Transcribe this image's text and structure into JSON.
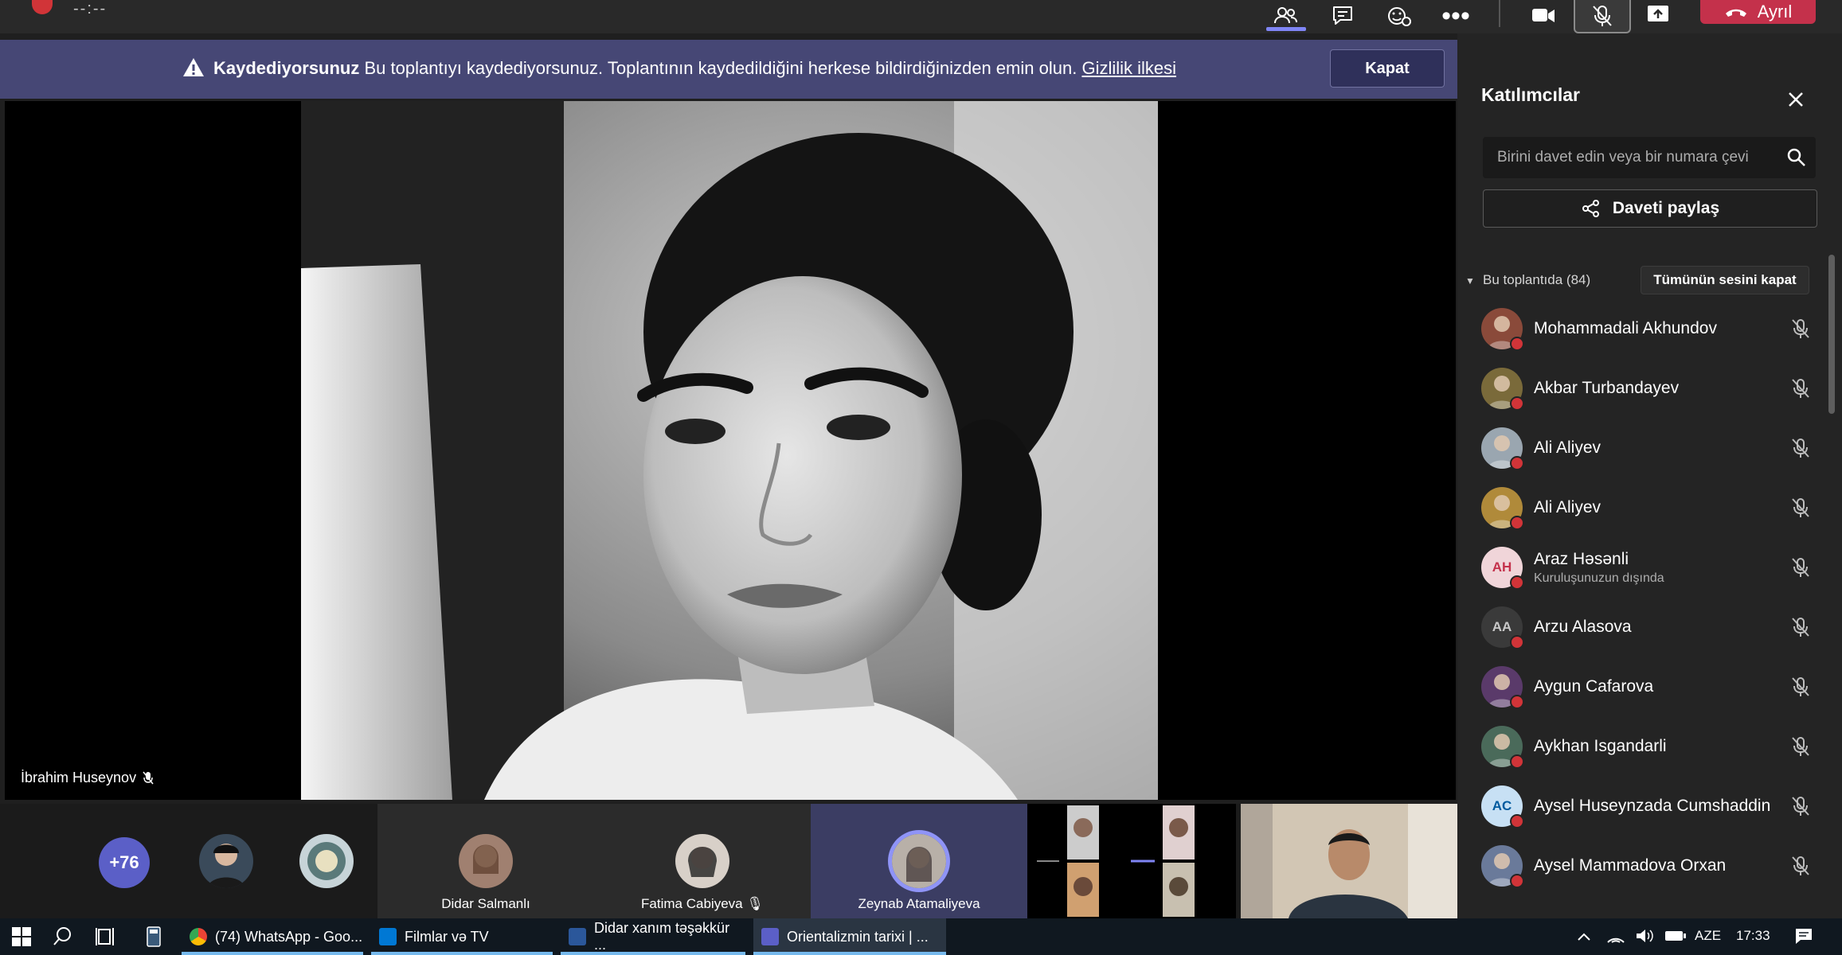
{
  "toolbar": {
    "timer": "--:--",
    "leave_label": "Ayrıl"
  },
  "banner": {
    "title": "Kaydediyorsunuz",
    "message": "Bu toplantıyı kaydediyorsunuz. Toplantının kaydedildiğini herkese bildirdiğinizden emin olun.",
    "link": "Gizlilik ilkesi",
    "close_label": "Kapat"
  },
  "stage": {
    "speaker_name": "İbrahim Huseynov"
  },
  "strip": {
    "more_count": "+76",
    "tiles": [
      {
        "name": "Didar Salmanlı"
      },
      {
        "name": "Fatima Cabiyeva"
      },
      {
        "name": "Zeynab Atamaliyeva"
      }
    ]
  },
  "panel": {
    "title": "Katılımcılar",
    "search_placeholder": "Birini davet edin veya bir numara çevi",
    "share_invite_label": "Daveti paylaş",
    "section_label": "Bu toplantıda (84)",
    "mute_all_label": "Tümünün sesini kapat",
    "participants": [
      {
        "name": "Mohammadali Akhundov",
        "subtitle": "",
        "initials": "",
        "color": "#8a4a3a"
      },
      {
        "name": "Akbar Turbandayev",
        "subtitle": "",
        "initials": "",
        "color": "#7a6a3a"
      },
      {
        "name": "Ali Aliyev",
        "subtitle": "",
        "initials": "",
        "color": "#9aa6b0"
      },
      {
        "name": "Ali Aliyev",
        "subtitle": "",
        "initials": "",
        "color": "#b08a3a"
      },
      {
        "name": "Araz Həsənli",
        "subtitle": "Kuruluşunuzun dışında",
        "initials": "AH",
        "color": "#f0d5d9"
      },
      {
        "name": "Arzu Alasova",
        "subtitle": "",
        "initials": "AA",
        "color": "#3a3a3a"
      },
      {
        "name": "Aygun Cafarova",
        "subtitle": "",
        "initials": "",
        "color": "#5a3a6a"
      },
      {
        "name": "Aykhan Isgandarli",
        "subtitle": "",
        "initials": "",
        "color": "#4a6a5a"
      },
      {
        "name": "Aysel Huseynzada Cumshaddin",
        "subtitle": "",
        "initials": "AC",
        "color": "#c7e0f4"
      },
      {
        "name": "Aysel Mammadova Orxan",
        "subtitle": "",
        "initials": "",
        "color": "#6a7a9a"
      }
    ]
  },
  "taskbar": {
    "apps": [
      {
        "label": "(74) WhatsApp - Goo..."
      },
      {
        "label": "Filmlar və TV"
      },
      {
        "label": "Didar xanım təşəkkür ..."
      },
      {
        "label": "Orientalizmin tarixi | ..."
      }
    ],
    "language": "AZE",
    "time": "17:33"
  },
  "colors": {
    "banner_bg": "#464775",
    "accent": "#5b5fc7",
    "leave_red": "#c4314b",
    "status_red": "#d13438"
  }
}
